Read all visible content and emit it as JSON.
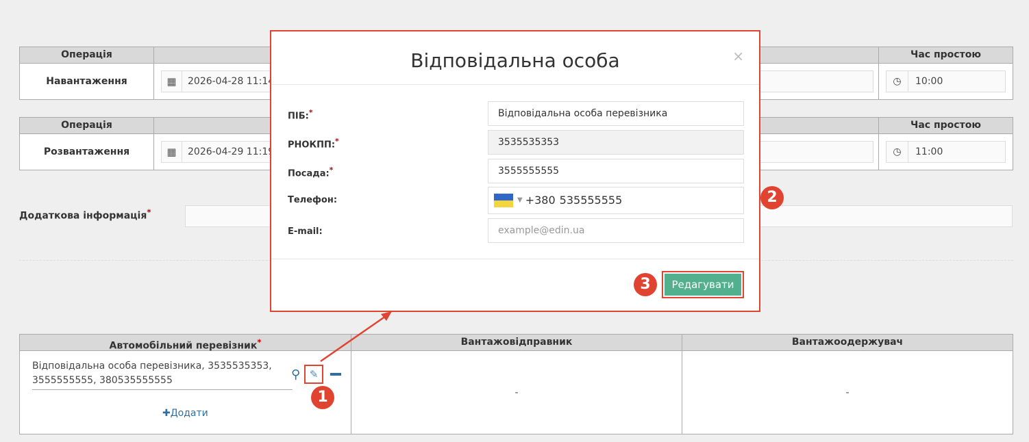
{
  "loading": {
    "col_operation": "Операція",
    "col_idle": "Час простою",
    "operation": "Навантаження",
    "datetime": "2026-04-28 11:14",
    "idle_time": "10:00"
  },
  "unloading": {
    "col_operation": "Операція",
    "col_idle": "Час простою",
    "operation": "Розвантаження",
    "datetime": "2026-04-29 11:19",
    "idle_time": "11:00"
  },
  "additional_info": {
    "label": "Додаткова інформація",
    "required": "*"
  },
  "participants": {
    "col_carrier": "Автомобільний перевізник",
    "required": "*",
    "col_shipper": "Вантажовідправник",
    "col_consignee": "Вантажоодержувач",
    "carrier_value": "Відповідальна особа перевізника, 3535535353, 3555555555, 380535555555",
    "shipper_value": "-",
    "consignee_value": "-",
    "add_label": "✚Додати"
  },
  "modal": {
    "title": "Відповідальна особа",
    "close": "×",
    "fields": {
      "name": {
        "label": "ПІБ:",
        "required": "*",
        "value": "Відповідальна особа перевізника"
      },
      "tax_id": {
        "label": "РНОКПП:",
        "required": "*",
        "value": "3535535353"
      },
      "position": {
        "label": "Посада:",
        "required": "*",
        "value": "3555555555"
      },
      "phone": {
        "label": "Телефон:",
        "code": "+380",
        "value": "535555555"
      },
      "email": {
        "label": "E-mail:",
        "placeholder": "example@edin.ua"
      }
    },
    "edit_button": "Редагувати"
  },
  "markers": [
    "1",
    "2",
    "3"
  ],
  "colors": {
    "accent": "#e0432f",
    "button": "#52b08f",
    "link": "#2f6ea5"
  }
}
